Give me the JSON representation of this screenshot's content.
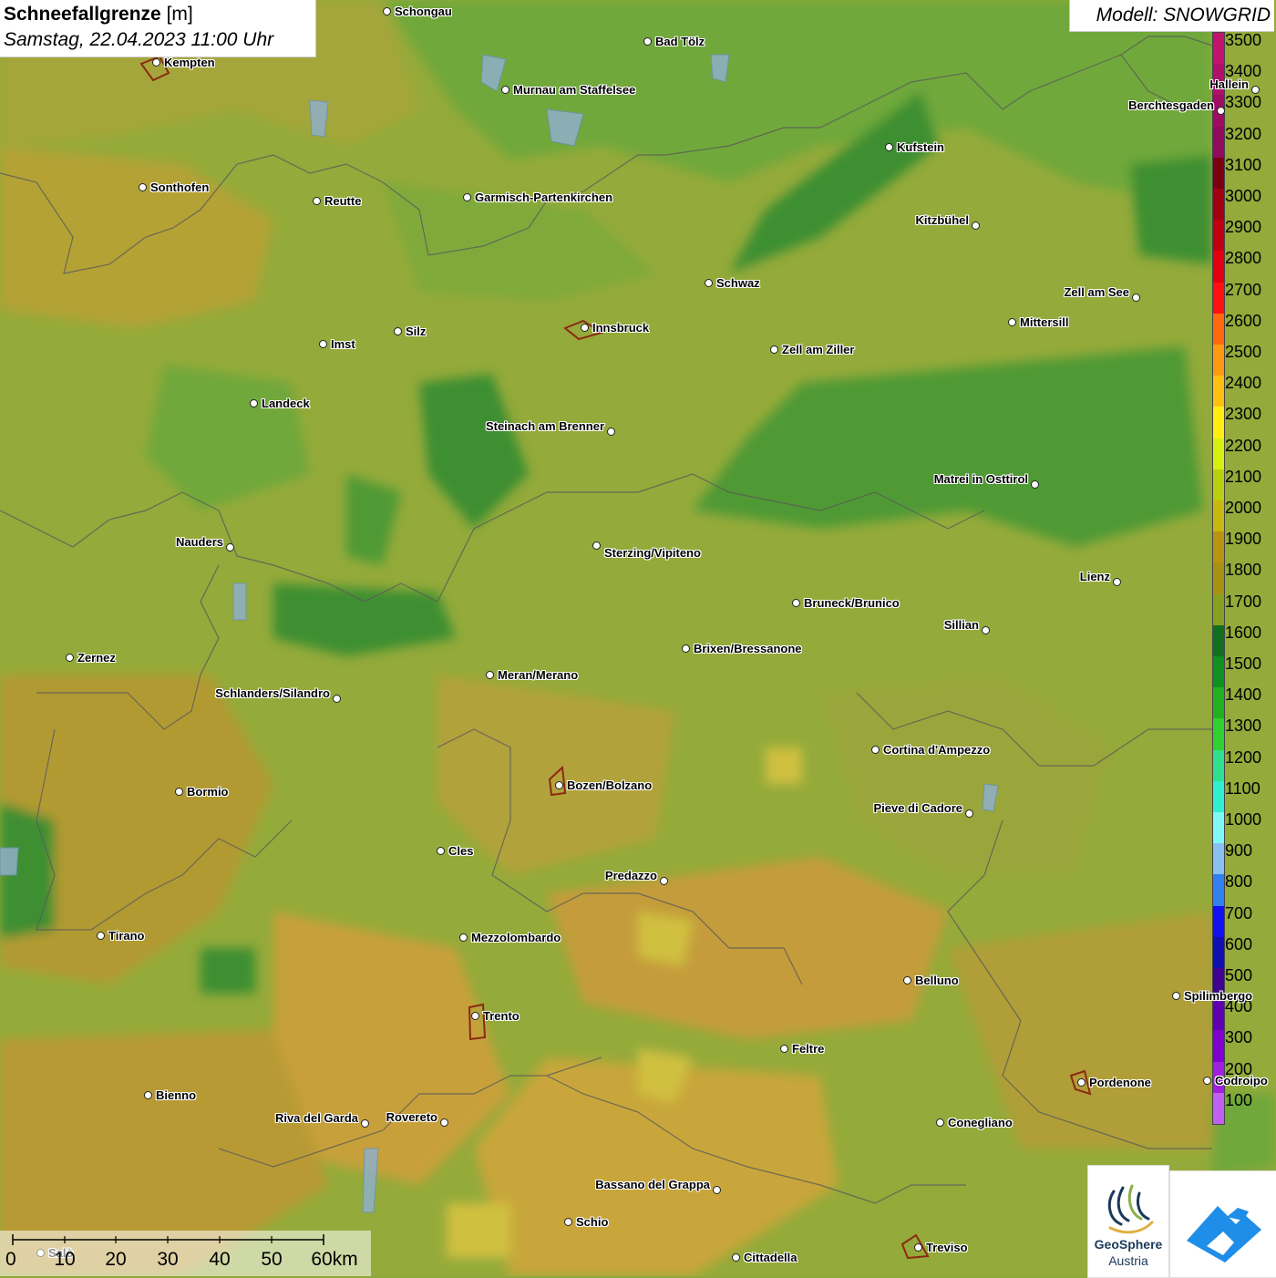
{
  "title": {
    "variable": "Schneefallgrenze",
    "unit": "[m]",
    "datetime": "Samstag, 22.04.2023 11:00 Uhr"
  },
  "model_label": "Modell: SNOWGRID",
  "legend": {
    "values": [
      "3500",
      "3400",
      "3300",
      "3200",
      "3100",
      "3000",
      "2900",
      "2800",
      "2700",
      "2600",
      "2500",
      "2400",
      "2300",
      "2200",
      "2100",
      "2000",
      "1900",
      "1800",
      "1700",
      "1600",
      "1500",
      "1400",
      "1300",
      "1200",
      "1100",
      "1000",
      "900",
      "800",
      "700",
      "600",
      "500",
      "400",
      "300",
      "200",
      "100"
    ],
    "colors": [
      "#c0146e",
      "#b00f6a",
      "#a00c64",
      "#900a5e",
      "#7a0010",
      "#a00010",
      "#c00010",
      "#e00010",
      "#ff1010",
      "#ff6a10",
      "#ff9a10",
      "#ffc010",
      "#ffee10",
      "#d8f010",
      "#b8d010",
      "#c8b810",
      "#b89410",
      "#a89010",
      "#88a020",
      "#107020",
      "#109020",
      "#20b020",
      "#30d030",
      "#30e090",
      "#30f0d0",
      "#80f8f8",
      "#88c0f0",
      "#3080f0",
      "#1010f0",
      "#1010b0",
      "#400090",
      "#6000b0",
      "#8000d0",
      "#a020e0",
      "#c060f0"
    ]
  },
  "cities": [
    {
      "name": "Schongau",
      "label": "Schongau"
    },
    {
      "name": "Bad Tölz",
      "label": "Bad Tölz"
    },
    {
      "name": "Kempten",
      "label": "Kempten"
    },
    {
      "name": "Murnau",
      "label": "Murnau am Staffelsee"
    },
    {
      "name": "Hallein",
      "label": "Hallein"
    },
    {
      "name": "Berchtesgaden",
      "label": "Berchtesgaden"
    },
    {
      "name": "Kufstein",
      "label": "Kufstein"
    },
    {
      "name": "Sonthofen",
      "label": "Sonthofen"
    },
    {
      "name": "Reutte",
      "label": "Reutte"
    },
    {
      "name": "Garmisch",
      "label": "Garmisch-Partenkirchen"
    },
    {
      "name": "Kitzbühel",
      "label": "Kitzbühel"
    },
    {
      "name": "Schwaz",
      "label": "Schwaz"
    },
    {
      "name": "Zell am See",
      "label": "Zell am See"
    },
    {
      "name": "Mittersill",
      "label": "Mittersill"
    },
    {
      "name": "Innsbruck",
      "label": "Innsbruck"
    },
    {
      "name": "Silz",
      "label": "Silz"
    },
    {
      "name": "Imst",
      "label": "Imst"
    },
    {
      "name": "Zell am Ziller",
      "label": "Zell am Ziller"
    },
    {
      "name": "Landeck",
      "label": "Landeck"
    },
    {
      "name": "Steinach",
      "label": "Steinach am Brenner"
    },
    {
      "name": "Matrei",
      "label": "Matrei in Osttirol"
    },
    {
      "name": "Nauders",
      "label": "Nauders"
    },
    {
      "name": "Sterzing",
      "label": "Sterzing/Vipiteno"
    },
    {
      "name": "Lienz",
      "label": "Lienz"
    },
    {
      "name": "Bruneck",
      "label": "Bruneck/Brunico"
    },
    {
      "name": "Sillian",
      "label": "Sillian"
    },
    {
      "name": "Zernez",
      "label": "Zernez"
    },
    {
      "name": "Brixen",
      "label": "Brixen/Bressanone"
    },
    {
      "name": "Meran",
      "label": "Meran/Merano"
    },
    {
      "name": "Schlanders",
      "label": "Schlanders/Silandro"
    },
    {
      "name": "Cortina",
      "label": "Cortina d'Ampezzo"
    },
    {
      "name": "Bozen",
      "label": "Bozen/Bolzano"
    },
    {
      "name": "Bormio",
      "label": "Bormio"
    },
    {
      "name": "Pieve",
      "label": "Pieve di Cadore"
    },
    {
      "name": "Cles",
      "label": "Cles"
    },
    {
      "name": "Predazzo",
      "label": "Predazzo"
    },
    {
      "name": "Tirano",
      "label": "Tirano"
    },
    {
      "name": "Mezzolombardo",
      "label": "Mezzolombardo"
    },
    {
      "name": "Belluno",
      "label": "Belluno"
    },
    {
      "name": "Spilimbergo",
      "label": "Spilimbergo"
    },
    {
      "name": "Trento",
      "label": "Trento"
    },
    {
      "name": "Feltre",
      "label": "Feltre"
    },
    {
      "name": "Pordenone",
      "label": "Pordenone"
    },
    {
      "name": "Codroipo",
      "label": "Codroipo"
    },
    {
      "name": "Bienno",
      "label": "Bienno"
    },
    {
      "name": "Riva",
      "label": "Riva del Garda"
    },
    {
      "name": "Rovereto",
      "label": "Rovereto"
    },
    {
      "name": "Conegliano",
      "label": "Conegliano"
    },
    {
      "name": "Bassano",
      "label": "Bassano del Grappa"
    },
    {
      "name": "Schio",
      "label": "Schio"
    },
    {
      "name": "Salo",
      "label": "Salò"
    },
    {
      "name": "Treviso",
      "label": "Treviso"
    },
    {
      "name": "Cittadella",
      "label": "Cittadella"
    }
  ],
  "scale": {
    "labels": [
      "0",
      "10",
      "20",
      "30",
      "40",
      "50",
      "60km"
    ]
  },
  "logos": {
    "geosphere_line1": "GeoSphere",
    "geosphere_line2": "Austria"
  }
}
